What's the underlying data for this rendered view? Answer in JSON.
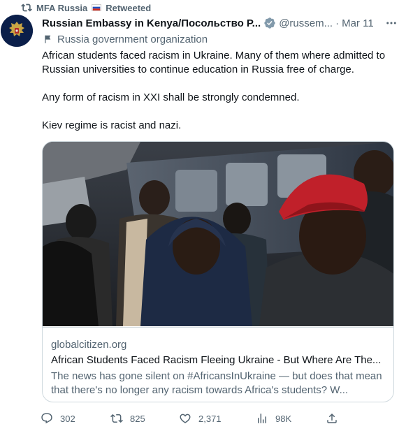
{
  "retweet": {
    "user": "MFA Russia",
    "label": "Retweeted"
  },
  "tweet": {
    "display_name": "Russian Embassy in Kenya/Посольство Р...",
    "handle": "@russem...",
    "separator": "·",
    "date": "Mar 11",
    "affiliation": "Russia government organization",
    "text": [
      "African students faced racism in Ukraine. Many of them where admitted to Russian universities to continue education in Russia free of charge.",
      "Any form of racism in XXI shall be strongly condemned.",
      "Kiev regime is racist and nazi."
    ]
  },
  "card": {
    "domain": "globalcitizen.org",
    "title": "African Students Faced Racism Fleeing Ukraine - But Where Are The...",
    "description": "The news has gone silent on #AfricansInUkraine — but does that mean that there's no longer any racism towards Africa's students? W..."
  },
  "actions": {
    "replies": "302",
    "retweets": "825",
    "likes": "2,371",
    "views": "98K"
  },
  "icons": {
    "retweet": "retweet-icon",
    "verified": "verified-badge-icon",
    "more": "more-icon",
    "affiliation": "flag-icon",
    "reply": "reply-icon",
    "like": "heart-icon",
    "views": "views-icon",
    "share": "share-icon"
  },
  "colors": {
    "text": "#0f1419",
    "secondary": "#536471",
    "verified": "#829aab",
    "border": "#cfd9de"
  }
}
